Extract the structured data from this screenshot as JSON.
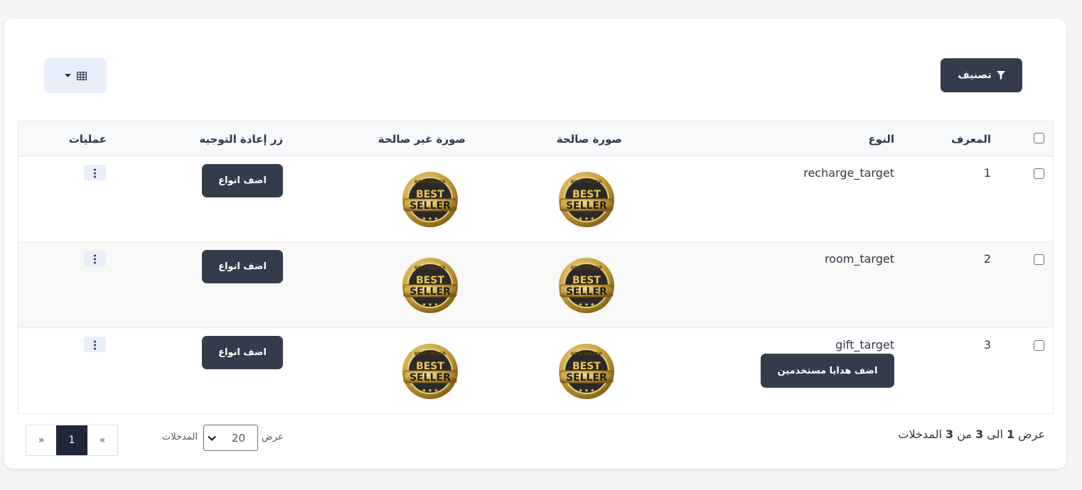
{
  "toolbar": {
    "filter_label": "تصنيف",
    "filter_icon": "filter-icon",
    "columns_icon": "table-grid-icon",
    "columns_caret": "caret-down-icon"
  },
  "table": {
    "headers": {
      "id": "المعرف",
      "type": "النوع",
      "valid_image": "صورة صالحة",
      "invalid_image": "صورة غير صالحة",
      "redirect_button": "زر إعادة التوجيه",
      "actions": "عمليات"
    },
    "image_alt": "BEST SELLER",
    "image_top": "BEST SELLER",
    "rows": [
      {
        "id": "1",
        "type": "recharge_target",
        "redirect_label": "اضف انواع"
      },
      {
        "id": "2",
        "type": "room_target",
        "redirect_label": "اضف انواع"
      },
      {
        "id": "3",
        "type": "gift_target",
        "redirect_label": "اضف انواع",
        "extra_button": "اضف هدايا مستخدمين"
      }
    ]
  },
  "footer": {
    "info_prefix": "عرض",
    "info_from": "1",
    "info_to_word": "الى",
    "info_to": "3",
    "info_of_word": "من",
    "info_total": "3",
    "info_suffix": "المدخلات",
    "length_show": "عرض",
    "length_value": "20",
    "length_entries": "المدخلات",
    "pager_prev": "«",
    "pager_current": "1",
    "pager_next": "»"
  },
  "colors": {
    "dark_button": "#343c4c",
    "light_button": "#e9eefb",
    "badge_gold": "#c9a23c",
    "badge_dark": "#2a2a2a"
  }
}
